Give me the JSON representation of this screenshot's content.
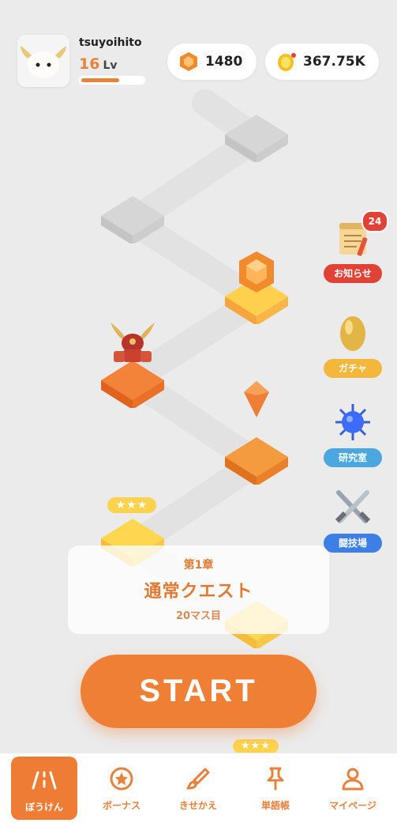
{
  "user": {
    "name": "tsuyoihito",
    "level": "16",
    "level_unit": "Lv",
    "xp_progress": 0.62
  },
  "currency": {
    "gems": "1480",
    "coins": "367.75K"
  },
  "side_menu": [
    {
      "label": "お知らせ",
      "badge": "24",
      "color": "#e04236",
      "icon": "notepad-icon"
    },
    {
      "label": "ガチャ",
      "color": "#f3b73b",
      "icon": "golden-egg-icon"
    },
    {
      "label": "研究室",
      "color": "#4aa7e0",
      "icon": "virus-icon"
    },
    {
      "label": "闘技場",
      "color": "#3d7fe6",
      "icon": "crossed-swords-icon"
    }
  ],
  "map": {
    "stars_1": "★★★",
    "stars_2": "★★★"
  },
  "quest": {
    "chapter": "第1章",
    "title": "通常クエスト",
    "subtitle": "20マス目"
  },
  "start_label": "START",
  "nav": [
    {
      "label": "ぼうけん",
      "icon": "road-icon",
      "active": true
    },
    {
      "label": "ボーナス",
      "icon": "star-circle-icon",
      "active": false
    },
    {
      "label": "きせかえ",
      "icon": "brush-icon",
      "active": false
    },
    {
      "label": "単語帳",
      "icon": "pin-icon",
      "active": false
    },
    {
      "label": "マイページ",
      "icon": "person-icon",
      "active": false
    }
  ],
  "colors": {
    "accent": "#ef7f35",
    "background": "#ebebeb"
  }
}
